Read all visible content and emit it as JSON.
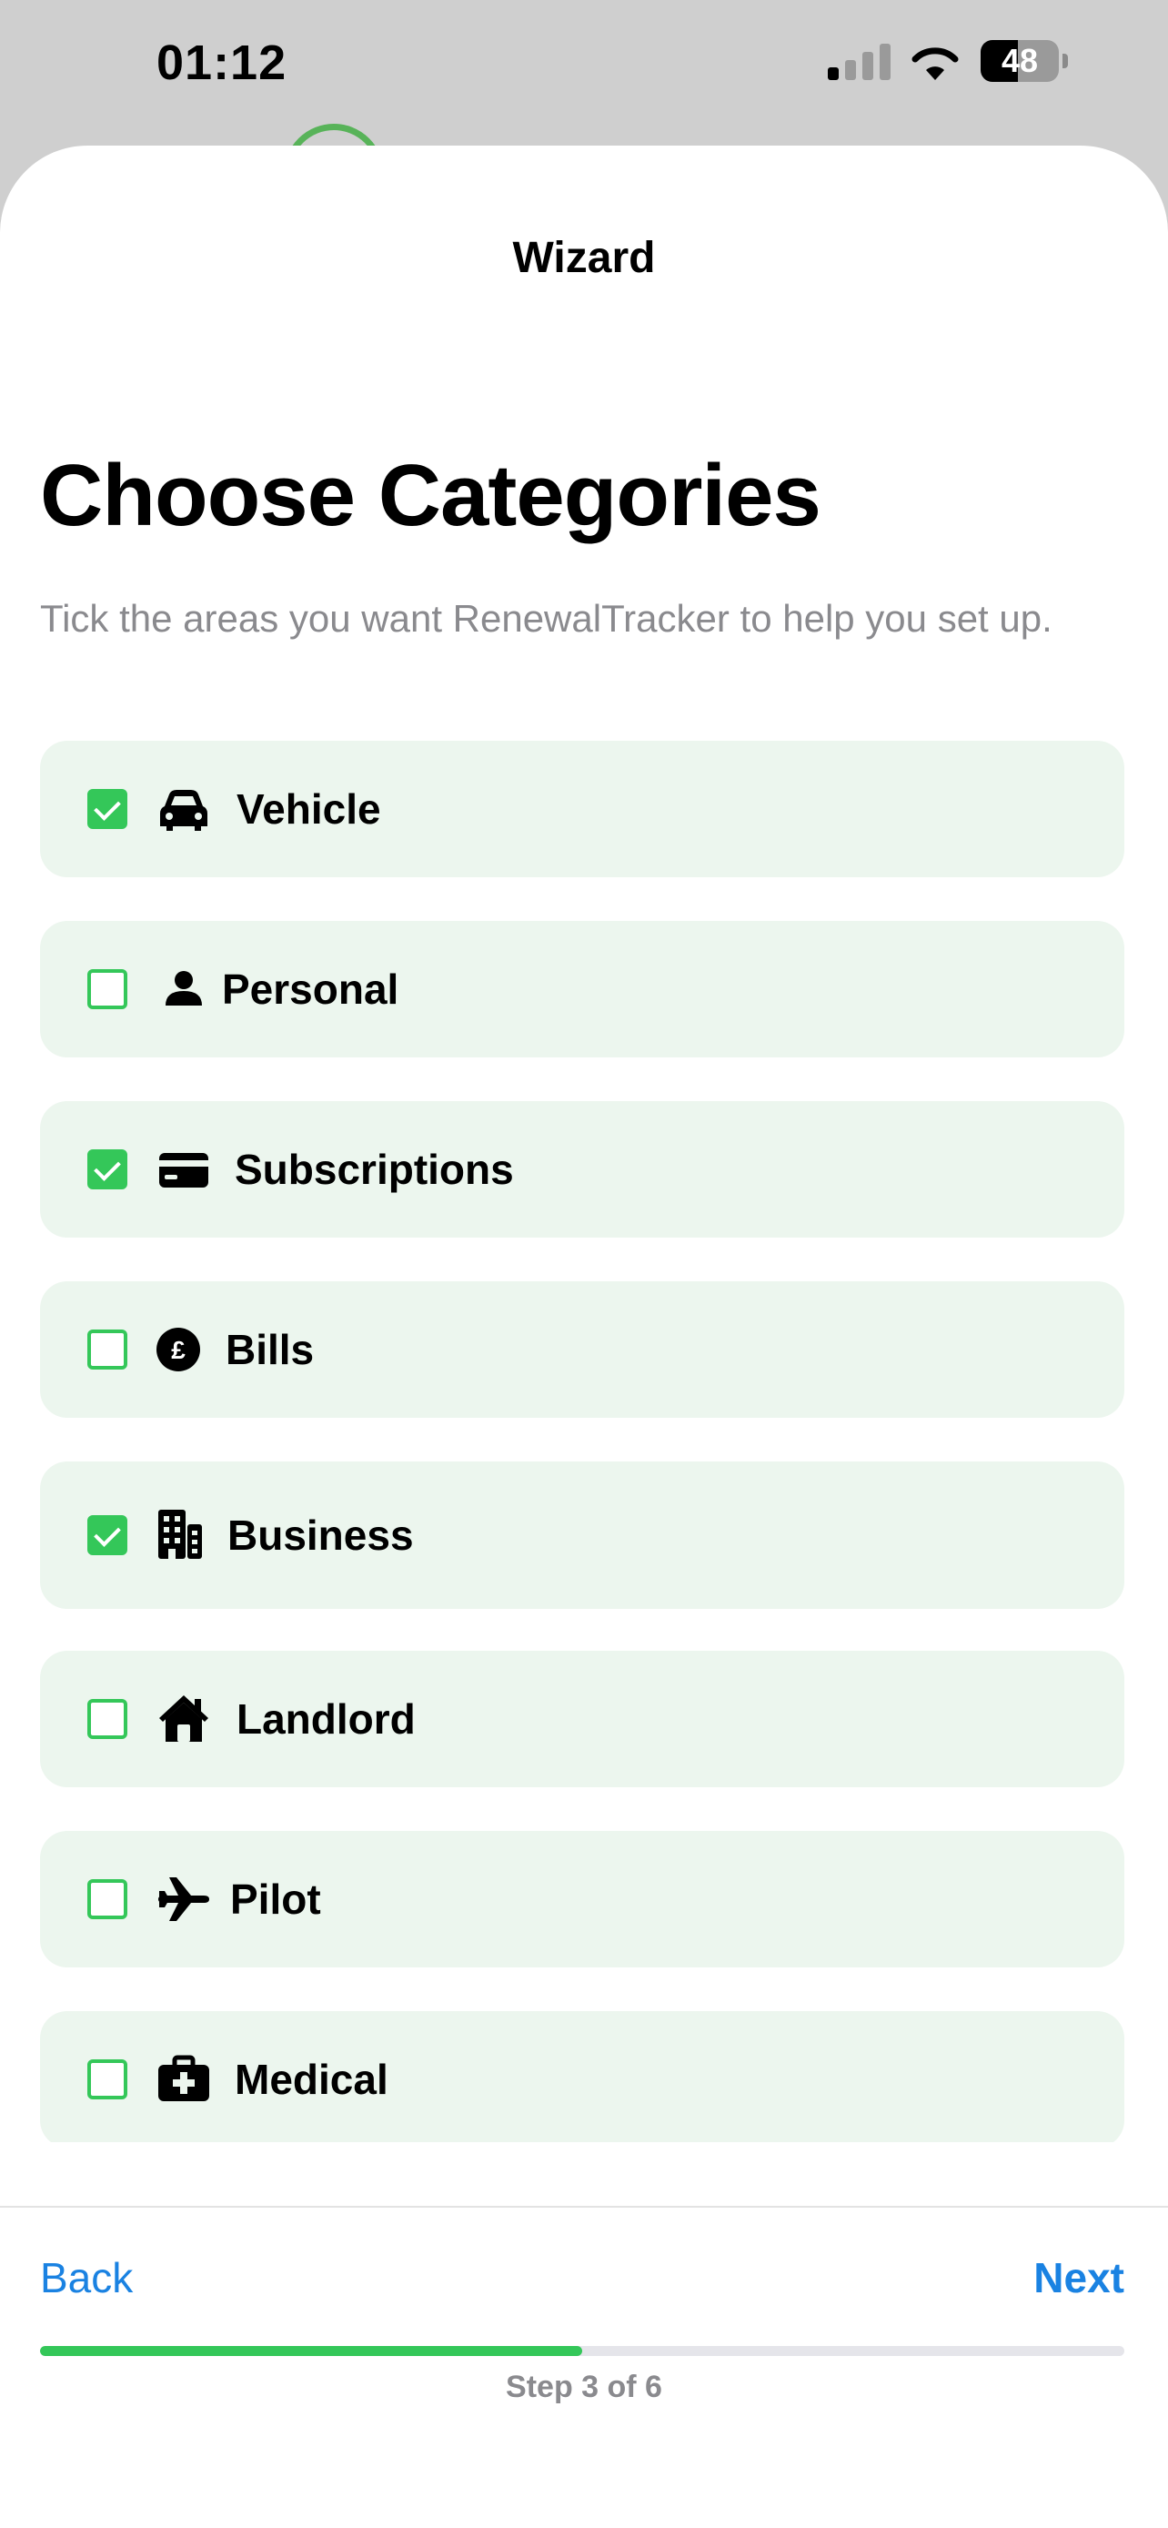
{
  "status_bar": {
    "time": "01:12",
    "battery": "48",
    "battery_level": 0.48
  },
  "nav": {
    "title": "Wizard"
  },
  "header": {
    "title": "Choose Categories",
    "subtitle": "Tick the areas you want RenewalTracker to help you set up."
  },
  "categories": [
    {
      "label": "Vehicle",
      "icon": "car-icon",
      "checked": true
    },
    {
      "label": "Personal",
      "icon": "person-icon",
      "checked": false
    },
    {
      "label": "Subscriptions",
      "icon": "credit-card-icon",
      "checked": true
    },
    {
      "label": "Bills",
      "icon": "pound-sign-icon",
      "checked": false
    },
    {
      "label": "Business",
      "icon": "building-icon",
      "checked": true
    },
    {
      "label": "Landlord",
      "icon": "house-icon",
      "checked": false
    },
    {
      "label": "Pilot",
      "icon": "airplane-icon",
      "checked": false
    },
    {
      "label": "Medical",
      "icon": "medical-kit-icon",
      "checked": false
    }
  ],
  "footer": {
    "back_label": "Back",
    "next_label": "Next",
    "progress_fraction": 0.5,
    "step_text": "Step 3 of 6"
  },
  "colors": {
    "accent_green": "#34c759",
    "link_blue": "#1a82e2",
    "row_background": "#ecf6ee"
  }
}
